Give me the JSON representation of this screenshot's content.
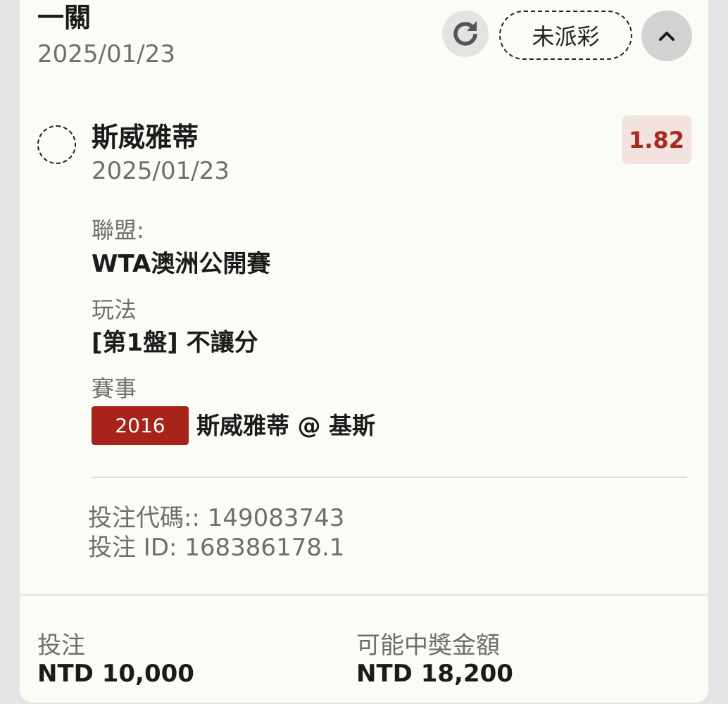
{
  "header": {
    "title": "一關",
    "date": "2025/01/23",
    "refresh_icon": "refresh-icon",
    "status": "未派彩",
    "collapse_icon": "chevron-up-icon"
  },
  "selection": {
    "name": "斯威雅蒂",
    "date": "2025/01/23",
    "odds": "1.82",
    "league_label": "聯盟:",
    "league_value": "WTA澳洲公開賽",
    "market_label": "玩法",
    "market_value": "[第1盤] 不讓分",
    "event_label": "賽事",
    "event_code": "2016",
    "event_name": "斯威雅蒂 @ 基斯"
  },
  "references": {
    "bet_code": "投注代碼:: 149083743",
    "bet_id": "投注 ID: 168386178.1"
  },
  "footer": {
    "stake_label": "投注",
    "stake_value": "NTD 10,000",
    "payout_label": "可能中獎金額",
    "payout_value": "NTD 18,200"
  },
  "colors": {
    "accent_red": "#a8241b",
    "odds_bg": "#f2e3df",
    "card_bg": "#fcfcf6"
  }
}
